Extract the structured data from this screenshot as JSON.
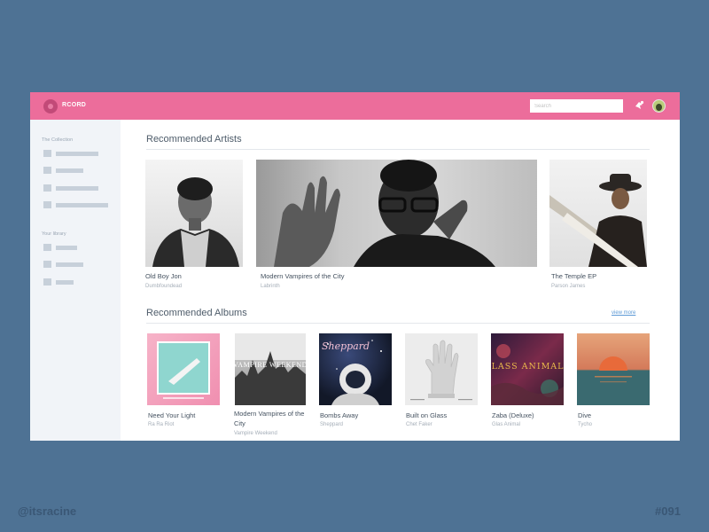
{
  "app": {
    "brand": "RCORD",
    "search_placeholder": "Search",
    "notifications_icon": "gear-icon",
    "avatar_label": "user-avatar"
  },
  "sidebar": {
    "collection_heading": "The Collection",
    "library_heading": "Your library"
  },
  "artists": {
    "title": "Recommended Artists",
    "items": [
      {
        "title": "Old Boy Jon",
        "subtitle": "Dumbfoundead"
      },
      {
        "title": "Modern Vampires of the City",
        "subtitle": "Labrinth"
      },
      {
        "title": "The Temple EP",
        "subtitle": "Parson James"
      }
    ]
  },
  "albums": {
    "title": "Recommended Albums",
    "view_more": "view more",
    "items": [
      {
        "title": "Need Your Light",
        "subtitle": "Ra Ra Riot",
        "cover_text": ""
      },
      {
        "title": "Modern Vampires of the City",
        "subtitle": "Vampire Weekend",
        "cover_text": "VAMPIRE WEEKEND"
      },
      {
        "title": "Bombs Away",
        "subtitle": "Sheppard",
        "cover_text": "Sheppard"
      },
      {
        "title": "Built on Glass",
        "subtitle": "Chet Faker",
        "cover_text": ""
      },
      {
        "title": "Zaba (Deluxe)",
        "subtitle": "Glas Animal",
        "cover_text": "GLASS ANIMALS"
      },
      {
        "title": "Dive",
        "subtitle": "Tycho",
        "cover_text": ""
      }
    ]
  },
  "footer": {
    "handle": "@itsracine",
    "shot_number": "#091"
  },
  "colors": {
    "page_background": "#4e7294",
    "topbar": "#ec6d9b",
    "sidebar": "#f1f4f8",
    "link": "#5d9ad6"
  }
}
